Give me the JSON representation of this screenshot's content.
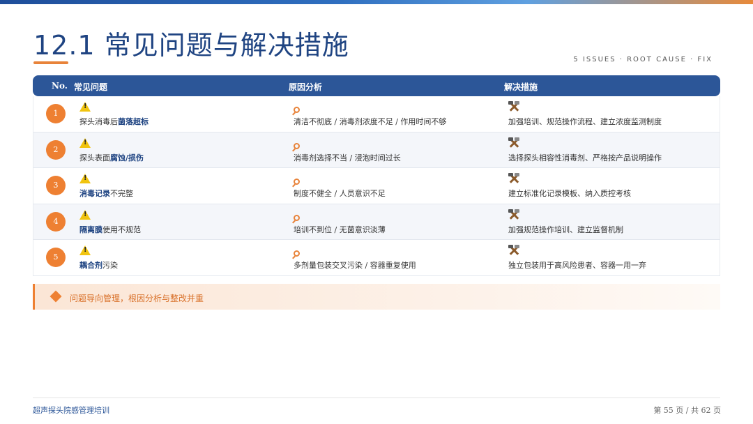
{
  "header": {
    "title": "12.1 常见问题与解决措施",
    "subtitle": "5 ISSUES · ROOT CAUSE · FIX"
  },
  "table": {
    "columns": [
      "No.",
      "常见问题",
      "原因分析",
      "解决措施"
    ],
    "rows": [
      {
        "no": "1",
        "problem_pre": "探头消毒后",
        "problem_key": "菌落超标",
        "problem_post": "",
        "cause": "清洁不彻底 / 消毒剂浓度不足 / 作用时间不够",
        "fix": "加强培训、规范操作流程、建立浓度监测制度"
      },
      {
        "no": "2",
        "problem_pre": "探头表面",
        "problem_key": "腐蚀/损伤",
        "problem_post": "",
        "cause": "消毒剂选择不当 / 浸泡时间过长",
        "fix": "选择探头相容性消毒剂、严格按产品说明操作"
      },
      {
        "no": "3",
        "problem_pre": "",
        "problem_key": "消毒记录",
        "problem_post": "不完整",
        "cause": "制度不健全 / 人员意识不足",
        "fix": "建立标准化记录模板、纳入质控考核"
      },
      {
        "no": "4",
        "problem_pre": "",
        "problem_key": "隔离膜",
        "problem_post": "使用不规范",
        "cause": "培训不到位 / 无菌意识淡薄",
        "fix": "加强规范操作培训、建立监督机制"
      },
      {
        "no": "5",
        "problem_pre": "",
        "problem_key": "耦合剂",
        "problem_post": "污染",
        "cause": "多剂量包装交叉污染 / 容器重复使用",
        "fix": "独立包装用于高风险患者、容器一用一弃"
      }
    ],
    "icons": {
      "problem": "warning-icon",
      "cause": "magnifier-icon",
      "fix": "tools-icon"
    }
  },
  "callout": {
    "text": "问题导向管理，根因分析与整改并重"
  },
  "footer": {
    "left": "超声探头院感管理培训",
    "right": "第 55 页 / 共 62 页"
  },
  "colors": {
    "primary": "#2c5698",
    "accent": "#ee8032",
    "title": "#1f4482"
  }
}
